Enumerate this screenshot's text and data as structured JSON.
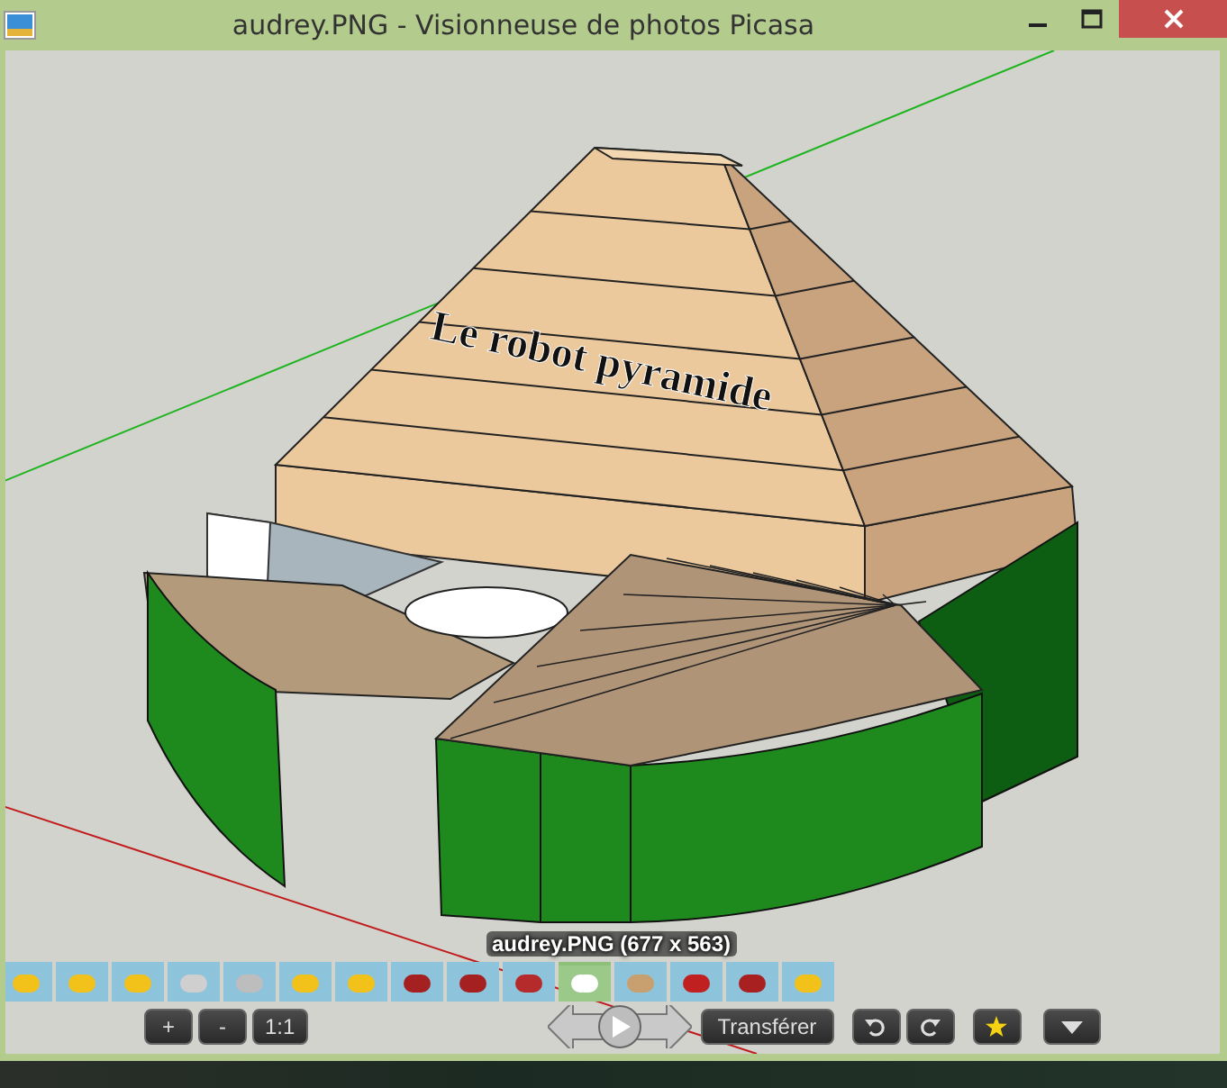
{
  "window": {
    "title": "audrey.PNG - Visionneuse de photos Picasa"
  },
  "image": {
    "model_label": "Le robot pyramide"
  },
  "caption": "audrey.PNG (677 x 563)",
  "thumbnails": [
    {
      "selected": false
    },
    {
      "selected": false
    },
    {
      "selected": false
    },
    {
      "selected": false
    },
    {
      "selected": false
    },
    {
      "selected": false
    },
    {
      "selected": false
    },
    {
      "selected": false
    },
    {
      "selected": false
    },
    {
      "selected": false
    },
    {
      "selected": true
    },
    {
      "selected": false
    },
    {
      "selected": false
    },
    {
      "selected": false
    },
    {
      "selected": false
    }
  ],
  "toolbar": {
    "zoom_buttons": [
      "+",
      "-",
      "1:1"
    ],
    "transfer_button": "Transférer"
  }
}
